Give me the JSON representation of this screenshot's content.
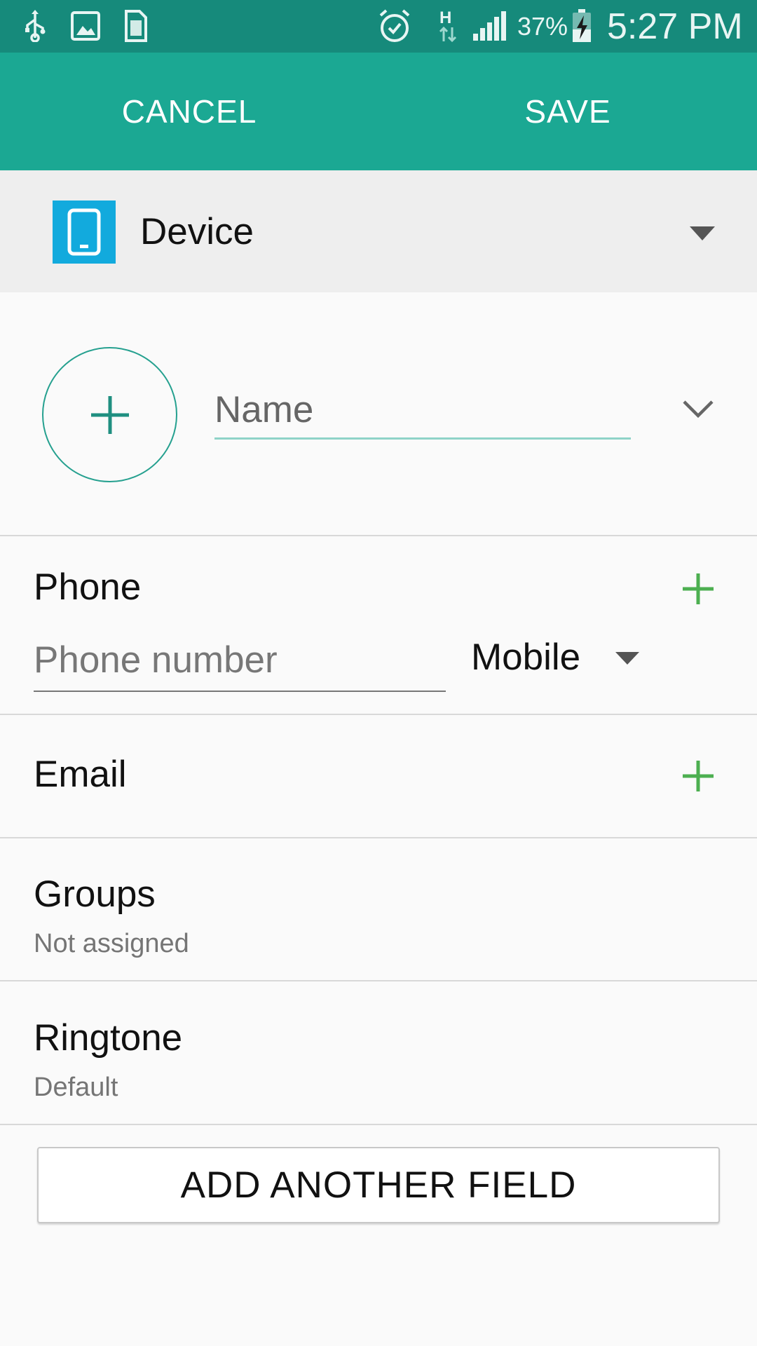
{
  "status_bar": {
    "battery_percent": "37%",
    "time": "5:27 PM",
    "left_icons": [
      "usb-icon",
      "image-icon",
      "sim-icon"
    ],
    "right_icons": [
      "alarm-icon",
      "network-h-icon",
      "signal-icon",
      "battery-charging-icon"
    ]
  },
  "action_bar": {
    "cancel_label": "CANCEL",
    "save_label": "SAVE"
  },
  "account": {
    "label": "Device",
    "icon": "device-icon"
  },
  "name": {
    "placeholder": "Name",
    "value": ""
  },
  "phone": {
    "label": "Phone",
    "placeholder": "Phone number",
    "type": "Mobile"
  },
  "email": {
    "label": "Email"
  },
  "groups": {
    "label": "Groups",
    "value": "Not assigned"
  },
  "ringtone": {
    "label": "Ringtone",
    "value": "Default"
  },
  "add_field_label": "ADD ANOTHER FIELD",
  "colors": {
    "status_bar": "#168a7b",
    "action_bar": "#1ba893",
    "accent_green": "#4caf50",
    "device_blue": "#12aadd"
  }
}
